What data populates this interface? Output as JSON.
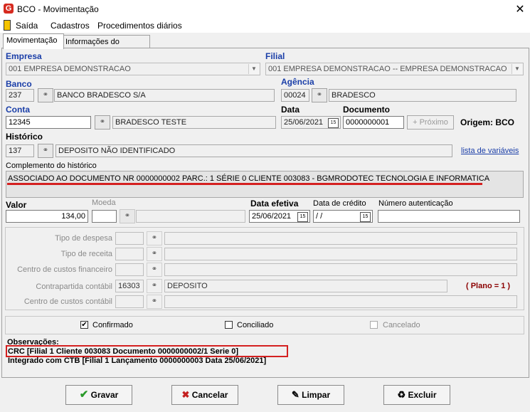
{
  "window": {
    "title": "BCO - Movimentação",
    "close": "✕"
  },
  "menu": {
    "items": [
      "Saída",
      "Cadastros",
      "Procedimentos diários"
    ]
  },
  "tabs": [
    "Movimentação",
    "Informações do sistema"
  ],
  "empresa": {
    "label": "Empresa",
    "value": "001 EMPRESA DEMONSTRACAO"
  },
  "filial": {
    "label": "Filial",
    "value": "001 EMPRESA DEMONSTRACAO -- EMPRESA DEMONSTRACAO"
  },
  "banco": {
    "label": "Banco",
    "code": "237",
    "name": "BANCO BRADESCO S/A"
  },
  "agencia": {
    "label": "Agência",
    "code": "00024",
    "name": "BRADESCO"
  },
  "conta": {
    "label": "Conta",
    "code": "12345",
    "name": "BRADESCO TESTE"
  },
  "data": {
    "label": "Data",
    "value": "25/06/2021"
  },
  "documento": {
    "label": "Documento",
    "value": "0000000001"
  },
  "proximo": {
    "label": "Próximo",
    "icon": "+"
  },
  "origem": {
    "text": "Origem: BCO"
  },
  "historico": {
    "label": "Histórico",
    "code": "137",
    "name": "DEPOSITO NÃO IDENTIFICADO",
    "link": "lista de variáveis"
  },
  "complemento": {
    "label": "Complemento do histórico",
    "value": "ASSOCIADO AO DOCUMENTO NR 0000000002 PARC.: 1 SÉRIE 0 CLIENTE 003083 - BGMRODOTEC TECNOLOGIA  E INFORMATICA"
  },
  "valor": {
    "label": "Valor",
    "value": "134,00"
  },
  "moeda": {
    "label": "Moeda"
  },
  "data_efetiva": {
    "label": "Data efetiva",
    "value": "25/06/2021"
  },
  "data_credito": {
    "label": "Data de crédito",
    "value": " /  /"
  },
  "num_autenticacao": {
    "label": "Número autenticação"
  },
  "rateio": {
    "tipo_despesa": "Tipo de despesa",
    "tipo_receita": "Tipo de receita",
    "centro_financeiro": "Centro de custos financeiro",
    "contrapartida": {
      "label": "Contrapartida contábil",
      "code": "16303",
      "name": "DEPOSITO"
    },
    "centro_contabil": "Centro de custos contábil",
    "plano": "( Plano = 1 )"
  },
  "checks": {
    "confirmado": {
      "label": "Confirmado",
      "checked": true
    },
    "conciliado": {
      "label": "Conciliado",
      "checked": false
    },
    "cancelado": {
      "label": "Cancelado",
      "checked": false
    }
  },
  "observacoes": {
    "label": "Observações:",
    "line1": "CRC [Filial 1 Cliente 003083 Documento 0000000002/1 Serie 0]",
    "line2": "Integrado com CTB [Filial 1 Lançamento 0000000003 Data 25/06/2021]"
  },
  "buttons": {
    "gravar": "Gravar",
    "cancelar": "Cancelar",
    "limpar": "Limpar",
    "excluir": "Excluir"
  },
  "icons": {
    "check": "✔",
    "x": "✖",
    "binoculars": "⚲",
    "calendar": "15",
    "combo": "▼"
  },
  "colors": {
    "highlight_red": "#d42020",
    "label_blue": "#1a3ea8",
    "plano": "#8b0000"
  }
}
